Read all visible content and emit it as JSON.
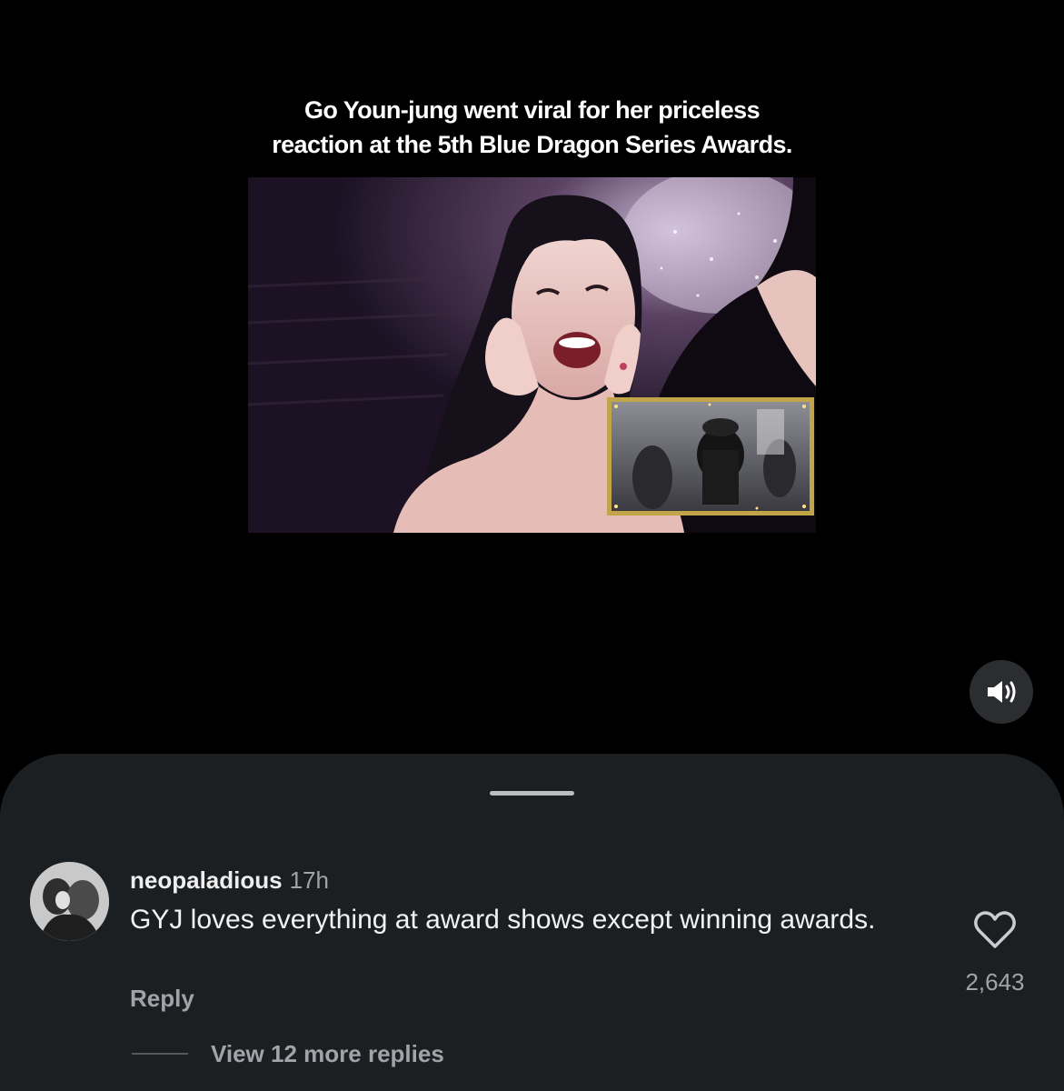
{
  "post": {
    "caption_line1": "Go Youn-jung went viral for her priceless",
    "caption_line2": "reaction at the 5th Blue Dragon Series Awards.",
    "media_description": "video",
    "sound_icon": "speaker-volume-icon"
  },
  "comments_sheet": {
    "comment": {
      "username": "neopaladious",
      "time": "17h",
      "text": "GYJ loves everything at award shows except winning awards.",
      "reply_label": "Reply",
      "like_icon": "heart-outline-icon",
      "like_count": "2,643",
      "view_replies_label": "View 12 more replies"
    }
  },
  "colors": {
    "background": "#000000",
    "sheet_background": "#1c1f22",
    "primary_text": "#f2f2f2",
    "secondary_text": "#a0a4a8"
  }
}
